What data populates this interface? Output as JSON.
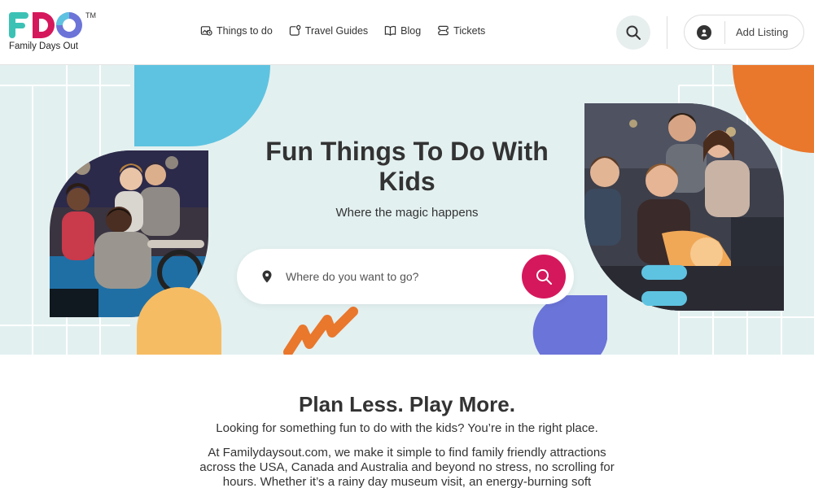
{
  "brand": {
    "logo_letters": [
      "F",
      "D",
      "O"
    ],
    "trademark": "TM",
    "subtitle": "Family Days Out",
    "colors": {
      "f": "#3cc2b5",
      "d": "#d5185c",
      "o": "#6c74d8"
    }
  },
  "nav": {
    "items": [
      {
        "label": "Things to do",
        "icon": "ticket-image-icon"
      },
      {
        "label": "Travel Guides",
        "icon": "map-pin-icon"
      },
      {
        "label": "Blog",
        "icon": "book-icon"
      },
      {
        "label": "Tickets",
        "icon": "ticket-icon"
      }
    ]
  },
  "header_actions": {
    "search_icon": "search-icon",
    "user_icon": "user-icon",
    "add_listing_label": "Add Listing"
  },
  "hero": {
    "title": "Fun Things To Do With Kids",
    "subtitle": "Where the magic happens",
    "search_placeholder": "Where do you want to go?",
    "colors": {
      "background": "#e3f0f0",
      "blue": "#5ec3e0",
      "orange": "#e9772c",
      "yellow": "#f6bc63",
      "purple": "#6b74d8",
      "pink": "#d5185c"
    }
  },
  "intro": {
    "title": "Plan Less. Play More.",
    "subtitle": "Looking for something fun to do with the kids? You’re in the right place.",
    "body": "At Familydaysout.com, we make it simple to find family friendly attractions across the USA, Canada and Australia and beyond no stress, no scrolling for hours. Whether it’s a rainy day museum visit, an energy-burning soft"
  }
}
